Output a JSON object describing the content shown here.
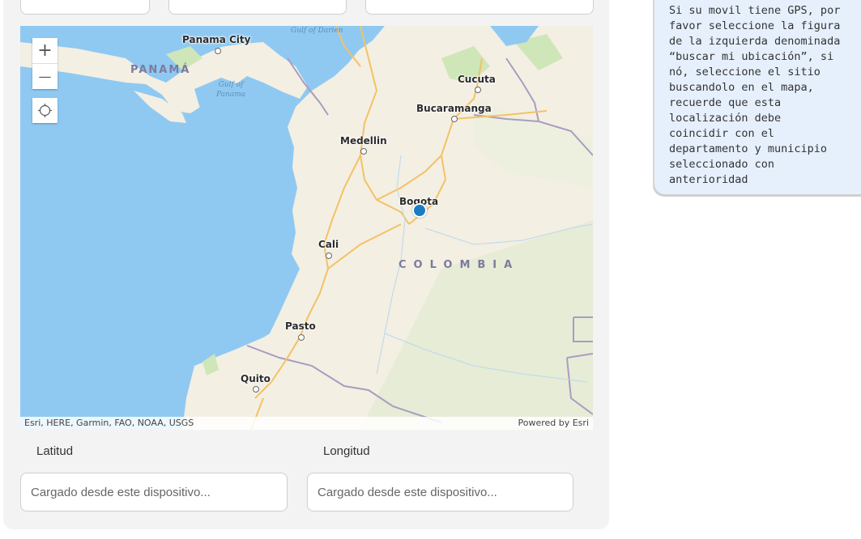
{
  "map": {
    "labels": {
      "panama_city": "Panama City",
      "panama": "PANAMÁ",
      "gulf_of_panama": "Gulf of Panama",
      "gulf_of_darien": "Gulf of Darien",
      "cucuta": "Cucuta",
      "bucaramanga": "Bucaramanga",
      "medellin": "Medellin",
      "bogota": "Bogota",
      "cali": "Cali",
      "colombia": "COLOMBIA",
      "pasto": "Pasto",
      "quito": "Quito"
    },
    "controls": {
      "zoom_in": "+",
      "zoom_out": "—"
    },
    "attribution": {
      "sources": "Esri, HERE, Garmin, FAO, NOAA, USGS",
      "powered_by": "Powered by Esri"
    },
    "colors": {
      "water": "#8fc9f2",
      "land": "#f3efe3",
      "marker": "#1a7bc4",
      "roads": "#f4c264",
      "borders": "#a99cc2"
    }
  },
  "form": {
    "latitud_label": "Latitud",
    "longitud_label": "Longitud",
    "latitud_placeholder": "Cargado desde este dispositivo...",
    "longitud_placeholder": "Cargado desde este dispositivo..."
  },
  "help": {
    "text": "Si su movil tiene GPS, por favor seleccione la figura de la izquierda denominada “buscar mi ubicación”, si nó, seleccione el sitio buscandolo en el mapa, recuerde que esta localización debe coincidir con el departamento y municipio seleccionado con anterioridad"
  }
}
